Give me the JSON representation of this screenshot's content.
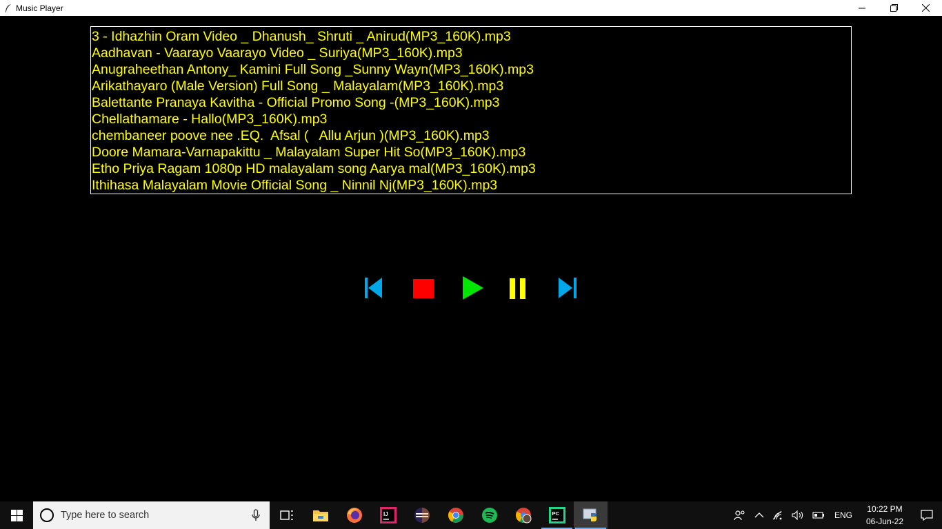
{
  "window": {
    "title": "Music Player"
  },
  "playlist": {
    "songs": [
      "3 - Idhazhin Oram Video _ Dhanush_ Shruti _ Anirud(MP3_160K).mp3",
      "Aadhavan - Vaarayo Vaarayo Video _ Suriya(MP3_160K).mp3",
      "Anugraheethan Antony_ Kamini Full Song _Sunny Wayn(MP3_160K).mp3",
      "Arikathayaro (Male Version) Full Song _ Malayalam(MP3_160K).mp3",
      "Balettante Pranaya Kavitha - Official Promo Song -(MP3_160K).mp3",
      "Chellathamare - Hallo(MP3_160K).mp3",
      "chembaneer poove nee .EQ.  Afsal (   Allu Arjun )(MP3_160K).mp3",
      "Doore Mamara-Varnapakittu _ Malayalam Super Hit So(MP3_160K).mp3",
      "Etho Priya Ragam 1080p HD malayalam song Aarya mal(MP3_160K).mp3",
      "Ithihasa Malayalam Movie Official Song _ Ninnil Nj(MP3_160K).mp3"
    ],
    "text_color": "#ffff00",
    "background": "#000000"
  },
  "controls": {
    "previous_color": "#00a8e8",
    "stop_color": "#ff0000",
    "play_color": "#00e600",
    "pause_color": "#ffff00",
    "next_color": "#00a8e8"
  },
  "taskbar": {
    "search_placeholder": "Type here to search",
    "apps": [
      "task-view",
      "file-explorer",
      "firefox",
      "intellij",
      "eclipse",
      "chrome",
      "spotify",
      "chrome-profile",
      "pycharm",
      "python"
    ],
    "language": "ENG",
    "time": "10:22 PM",
    "date": "06-Jun-22"
  }
}
